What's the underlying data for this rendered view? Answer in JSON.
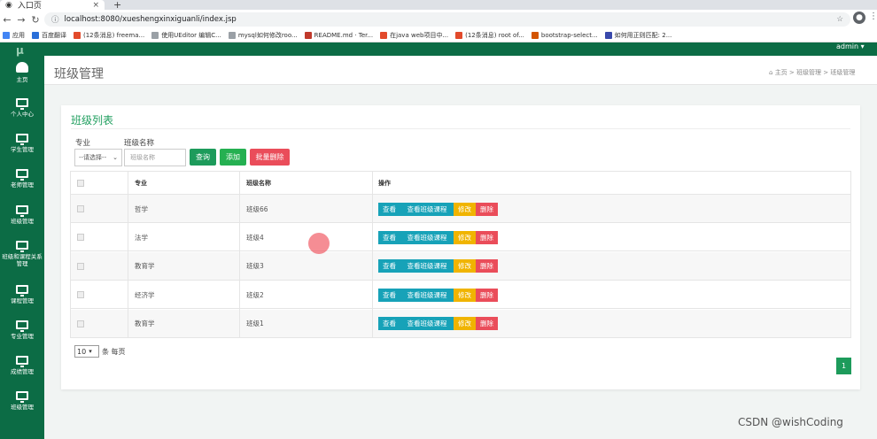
{
  "browser": {
    "tab_title": "入口页",
    "url": "localhost:8080/xueshengxinxiguanli/index.jsp",
    "bookmarks": [
      {
        "label": "应用",
        "color": "#4285f4"
      },
      {
        "label": "百度翻译",
        "color": "#2a6fd9"
      },
      {
        "label": "(12条消息) freema...",
        "color": "#e24a2b"
      },
      {
        "label": "使用UEditor 编辑C...",
        "color": "#9aa0a6"
      },
      {
        "label": "mysql如何修改roo...",
        "color": "#9aa0a6"
      },
      {
        "label": "README.md · Ter...",
        "color": "#c0392b"
      },
      {
        "label": "在java web项目中...",
        "color": "#e24a2b"
      },
      {
        "label": "(12条消息) root of...",
        "color": "#e24a2b"
      },
      {
        "label": "bootstrap-select...",
        "color": "#d35400"
      },
      {
        "label": "如何用正则匹配: 2...",
        "color": "#3949ab"
      }
    ]
  },
  "app": {
    "logo": "μ",
    "admin": "admin ▾",
    "sidebar": [
      {
        "label": "主页"
      },
      {
        "label": "个人中心"
      },
      {
        "label": "学生管理"
      },
      {
        "label": "老师管理"
      },
      {
        "label": "班级管理"
      },
      {
        "label": "班级和课程关系管理"
      },
      {
        "label": "课程管理"
      },
      {
        "label": "专业管理"
      },
      {
        "label": "成绩管理"
      },
      {
        "label": "班级管理"
      }
    ]
  },
  "page": {
    "title": "班级管理",
    "breadcrumb": {
      "home": "主页",
      "section": "班级管理",
      "current": "班级管理",
      "sep": ">"
    }
  },
  "card": {
    "title": "班级列表",
    "filters": {
      "major_label": "专业",
      "major_value": "--请选择--",
      "name_label": "班级名称",
      "name_placeholder": "班级名称",
      "query_btn": "查询",
      "add_btn": "添加",
      "batch_delete_btn": "批量删除"
    },
    "table": {
      "columns": [
        "专业",
        "班级名称",
        "操作"
      ],
      "actions": {
        "view": "查看",
        "view_course": "查看班级课程",
        "edit": "修改",
        "delete": "删除"
      },
      "rows": [
        {
          "major": "哲学",
          "name": "班级66"
        },
        {
          "major": "法学",
          "name": "班级4"
        },
        {
          "major": "教育学",
          "name": "班级3"
        },
        {
          "major": "经济学",
          "name": "班级2"
        },
        {
          "major": "教育学",
          "name": "班级1"
        }
      ]
    },
    "pagination": {
      "page_size": "10",
      "per_page_text": "条 每页",
      "current_page": "1"
    }
  },
  "watermark": "CSDN @wishCoding"
}
